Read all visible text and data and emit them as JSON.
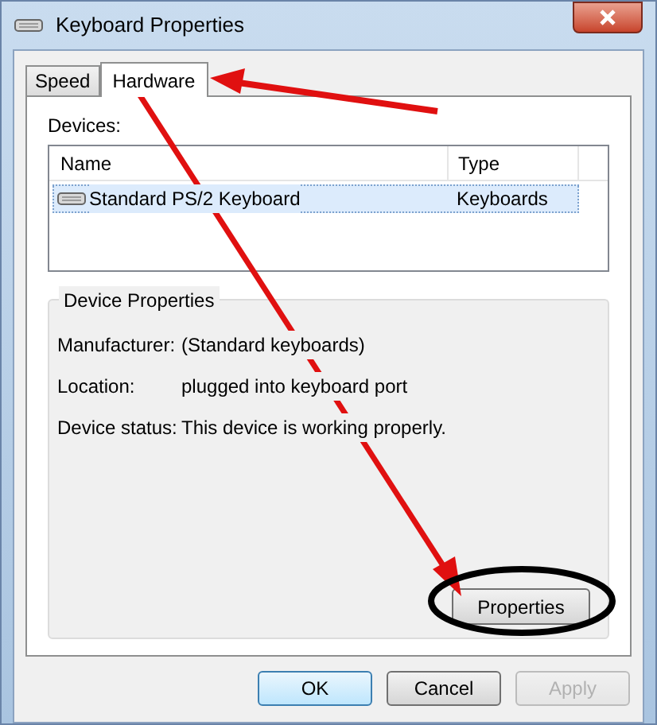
{
  "window": {
    "title": "Keyboard Properties"
  },
  "tabs": [
    {
      "label": "Speed",
      "selected": false
    },
    {
      "label": "Hardware",
      "selected": true
    }
  ],
  "devices": {
    "label": "Devices:",
    "columns": [
      "Name",
      "Type"
    ],
    "rows": [
      {
        "name": "Standard PS/2 Keyboard",
        "type": "Keyboards",
        "selected": true
      }
    ]
  },
  "device_properties": {
    "title": "Device Properties",
    "fields": [
      {
        "label": "Manufacturer:",
        "value": "(Standard keyboards)"
      },
      {
        "label": "Location:",
        "value": "plugged into keyboard port"
      },
      {
        "label": "Device status:",
        "value": "This device is working properly."
      }
    ],
    "button": "Properties"
  },
  "buttons": [
    {
      "label": "OK",
      "default": true,
      "disabled": false
    },
    {
      "label": "Cancel",
      "default": false,
      "disabled": false
    },
    {
      "label": "Apply",
      "default": false,
      "disabled": true
    }
  ]
}
